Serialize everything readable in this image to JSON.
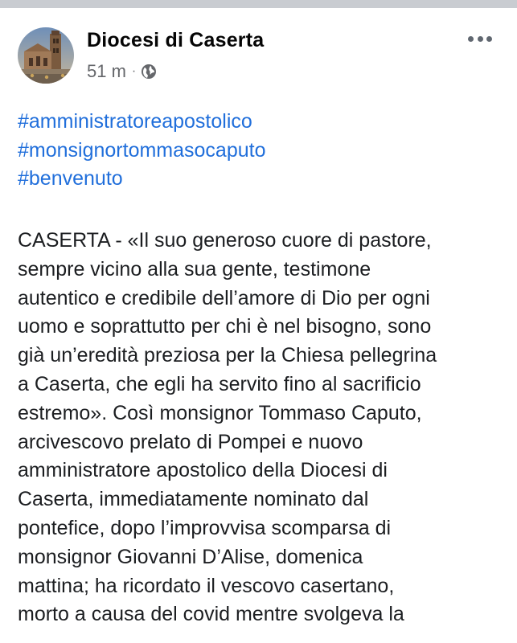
{
  "post": {
    "author": "Diocesi di Caserta",
    "time": "51 m",
    "separator": "·",
    "privacy_icon": "globe-icon",
    "more_icon": "more-horizontal-icon",
    "avatar": "cathedral-photo",
    "hashtags": [
      "#amministratoreapostolico",
      "#monsignortommasocaputo",
      "#benvenuto"
    ],
    "body_lines": [
      "CASERTA - «Il suo generoso cuore di pastore,",
      "sempre vicino alla sua gente, testimone",
      "autentico e credibile dell’amore di Dio per ogni",
      "uomo e soprattutto per chi è nel bisogno, sono",
      "già un’eredità preziosa per la Chiesa pellegrina",
      "a Caserta, che egli ha servito fino al sacrificio",
      "estremo». Così monsignor Tommaso Caputo,",
      "arcivescovo prelato di Pompei e nuovo",
      "amministratore apostolico della Diocesi di",
      "Caserta, immediatamente nominato dal",
      "pontefice, dopo l’improvvisa scomparsa di",
      "monsignor  Giovanni D’Alise, domenica",
      "mattina; ha ricordato il vescovo casertano,",
      "morto a causa del covid mentre svolgeva la"
    ]
  },
  "colors": {
    "hashtag": "#216fdb",
    "text": "#1c1e21",
    "meta": "#65676b",
    "top_bar": "#c9ccd1"
  }
}
